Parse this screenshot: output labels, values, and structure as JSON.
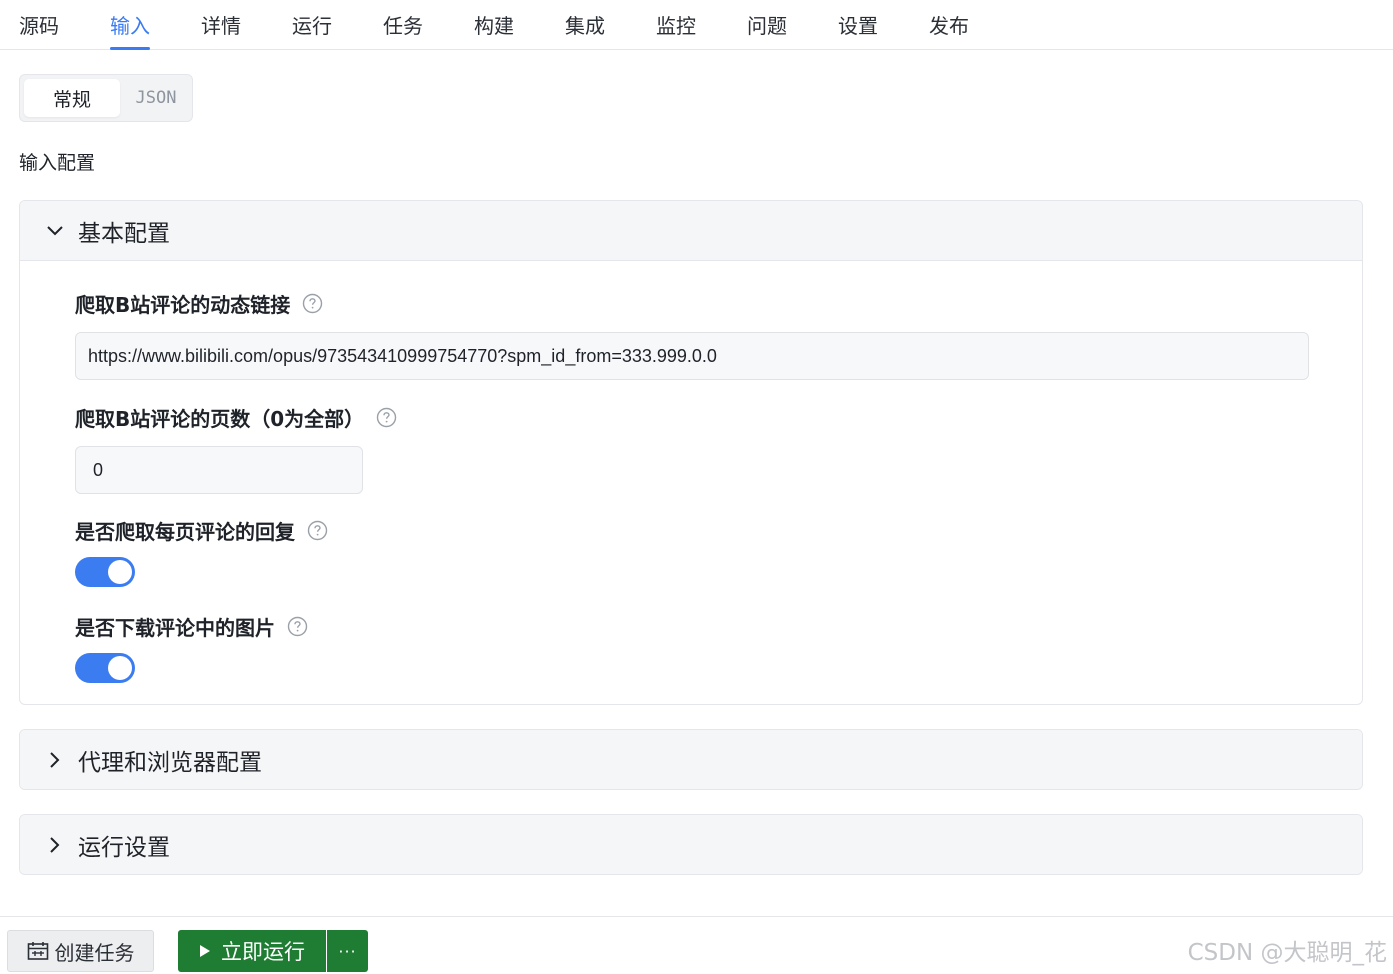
{
  "tabs": [
    "源码",
    "输入",
    "详情",
    "运行",
    "任务",
    "构建",
    "集成",
    "监控",
    "问题",
    "设置",
    "发布"
  ],
  "active_tab": "输入",
  "segmented": {
    "general": "常规",
    "json": "JSON"
  },
  "section_title": "输入配置",
  "panels": {
    "basic": {
      "title": "基本配置",
      "expanded": true,
      "fields": {
        "link": {
          "label": "爬取B站评论的动态链接",
          "value": "https://www.bilibili.com/opus/973543410999754770?spm_id_from=333.999.0.0"
        },
        "pages": {
          "label": "爬取B站评论的页数（0为全部）",
          "value": "0"
        },
        "replies": {
          "label": "是否爬取每页评论的回复",
          "enabled": true
        },
        "images": {
          "label": "是否下载评论中的图片",
          "enabled": true
        }
      }
    },
    "proxy": {
      "title": "代理和浏览器配置",
      "expanded": false
    },
    "run_settings": {
      "title": "运行设置",
      "expanded": false
    }
  },
  "footer": {
    "create_task": "创建任务",
    "run_now": "立即运行",
    "more": "···",
    "watermark": "CSDN @大聪明_花"
  },
  "colors": {
    "accent": "#3a7bf2",
    "run_button": "#1e7d32",
    "toggle_on": "#3b7cf1"
  },
  "icons": {
    "help": "question-circle-icon",
    "expand": "chevron-down-icon",
    "collapse": "chevron-right-icon",
    "create": "calendar-icon",
    "run": "play-icon"
  }
}
